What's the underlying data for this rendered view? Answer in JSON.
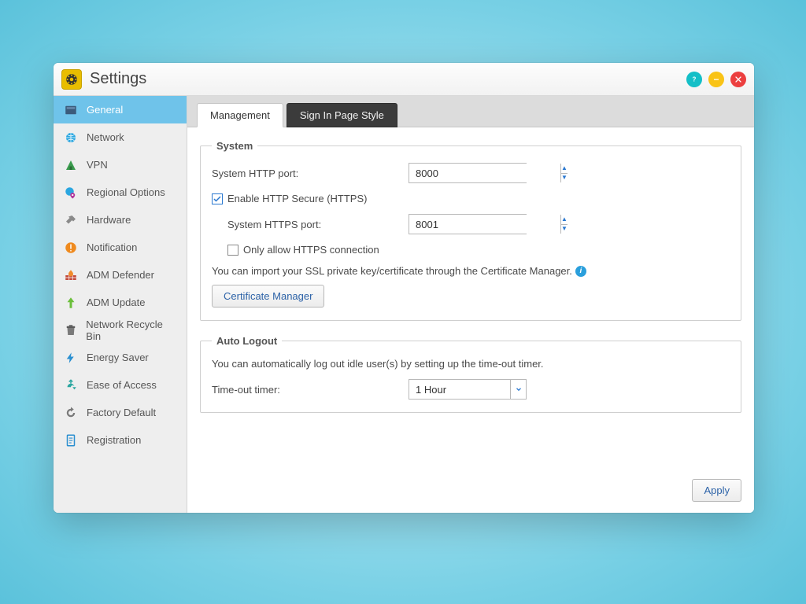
{
  "window": {
    "title": "Settings"
  },
  "sidebar": {
    "items": [
      {
        "label": "General"
      },
      {
        "label": "Network"
      },
      {
        "label": "VPN"
      },
      {
        "label": "Regional Options"
      },
      {
        "label": "Hardware"
      },
      {
        "label": "Notification"
      },
      {
        "label": "ADM Defender"
      },
      {
        "label": "ADM Update"
      },
      {
        "label": "Network Recycle Bin"
      },
      {
        "label": "Energy Saver"
      },
      {
        "label": "Ease of Access"
      },
      {
        "label": "Factory Default"
      },
      {
        "label": "Registration"
      }
    ],
    "selected_index": 0
  },
  "tabs": {
    "items": [
      {
        "label": "Management"
      },
      {
        "label": "Sign In Page Style"
      }
    ],
    "active_index": 0
  },
  "system_group": {
    "legend": "System",
    "http_port_label": "System HTTP port:",
    "http_port_value": "8000",
    "enable_https_label": "Enable HTTP Secure (HTTPS)",
    "enable_https_checked": true,
    "https_port_label": "System HTTPS port:",
    "https_port_value": "8001",
    "only_https_label": "Only allow HTTPS connection",
    "only_https_checked": false,
    "ssl_hint": "You can import your SSL private key/certificate through the Certificate Manager.",
    "cert_button": "Certificate Manager"
  },
  "autologout_group": {
    "legend": "Auto Logout",
    "hint": "You can automatically log out idle user(s) by setting up the time-out timer.",
    "timeout_label": "Time-out timer:",
    "timeout_value": "1 Hour"
  },
  "footer": {
    "apply": "Apply"
  }
}
